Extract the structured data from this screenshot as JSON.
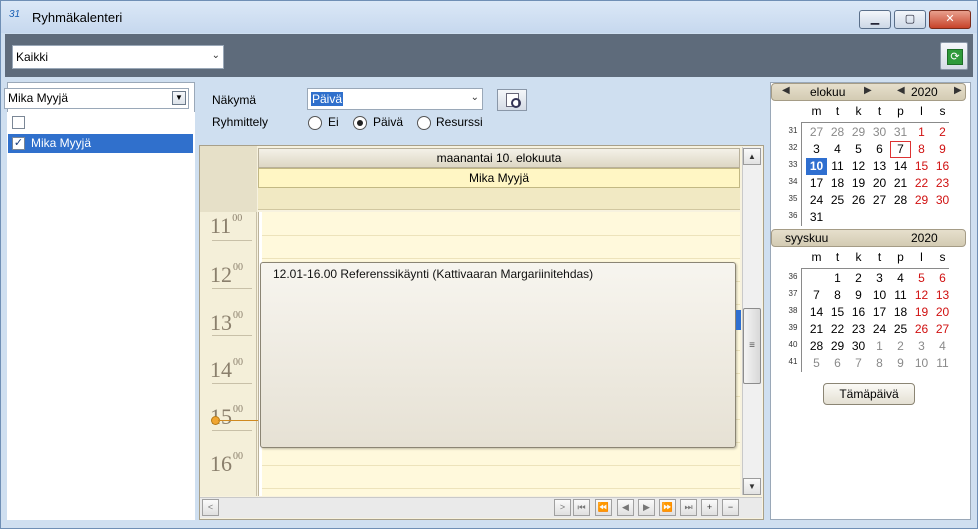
{
  "window": {
    "title": "Ryhmäkalenteri",
    "app_icon": "31",
    "buttons": {
      "minimize": "minimize-icon",
      "maximize": "maximize-icon",
      "close": "close-icon"
    }
  },
  "toolbar": {
    "filter_value": "Kaikki",
    "refresh_icon": "refresh-icon"
  },
  "left": {
    "user_select": "Mika Myyjä",
    "users": [
      {
        "label": "Mika Myyjä",
        "checked": true
      }
    ]
  },
  "controls": {
    "view_label": "Näkymä",
    "view_value": "Päivä",
    "grouping_label": "Ryhmittely",
    "grouping_options": [
      "Ei",
      "Päivä",
      "Resurssi"
    ],
    "grouping_selected": "Päivä"
  },
  "dayview": {
    "date_header": "maanantai 10. elokuuta",
    "resource_header": "Mika Myyjä",
    "hours": [
      {
        "h": "11",
        "m": "00"
      },
      {
        "h": "12",
        "m": "00"
      },
      {
        "h": "13",
        "m": "00"
      },
      {
        "h": "14",
        "m": "00"
      },
      {
        "h": "15",
        "m": "00"
      },
      {
        "h": "16",
        "m": "00"
      }
    ],
    "appointment": "12.01-16.00 Referenssikäynti (Kattivaaran Margariinitehdas)"
  },
  "navbar": [
    ">",
    "⏮",
    "⏪",
    "◀",
    "▶",
    "⏩",
    "⏭",
    "+",
    "−"
  ],
  "minical": {
    "weekday_headers": [
      "m",
      "t",
      "k",
      "t",
      "p",
      "l",
      "s"
    ],
    "months": [
      {
        "name": "elokuu",
        "year": "2020",
        "weeks": [
          {
            "wk": "31",
            "days": [
              "27",
              "28",
              "29",
              "30",
              "31",
              "1",
              "2"
            ],
            "other": [
              1,
              1,
              1,
              1,
              1,
              0,
              0
            ]
          },
          {
            "wk": "32",
            "days": [
              "3",
              "4",
              "5",
              "6",
              "7",
              "8",
              "9"
            ],
            "other": [
              0,
              0,
              0,
              0,
              0,
              0,
              0
            ]
          },
          {
            "wk": "33",
            "days": [
              "10",
              "11",
              "12",
              "13",
              "14",
              "15",
              "16"
            ],
            "other": [
              0,
              0,
              0,
              0,
              0,
              0,
              0
            ]
          },
          {
            "wk": "34",
            "days": [
              "17",
              "18",
              "19",
              "20",
              "21",
              "22",
              "23"
            ],
            "other": [
              0,
              0,
              0,
              0,
              0,
              0,
              0
            ]
          },
          {
            "wk": "35",
            "days": [
              "24",
              "25",
              "26",
              "27",
              "28",
              "29",
              "30"
            ],
            "other": [
              0,
              0,
              0,
              0,
              0,
              0,
              0
            ]
          },
          {
            "wk": "36",
            "days": [
              "31",
              "",
              "",
              "",
              "",
              "",
              ""
            ],
            "other": [
              0,
              0,
              0,
              0,
              0,
              0,
              0
            ]
          }
        ],
        "today": "10",
        "selected": "7"
      },
      {
        "name": "syyskuu",
        "year": "2020",
        "weeks": [
          {
            "wk": "36",
            "days": [
              "",
              "1",
              "2",
              "3",
              "4",
              "5",
              "6"
            ],
            "other": [
              0,
              0,
              0,
              0,
              0,
              0,
              0
            ]
          },
          {
            "wk": "37",
            "days": [
              "7",
              "8",
              "9",
              "10",
              "11",
              "12",
              "13"
            ],
            "other": [
              0,
              0,
              0,
              0,
              0,
              0,
              0
            ]
          },
          {
            "wk": "38",
            "days": [
              "14",
              "15",
              "16",
              "17",
              "18",
              "19",
              "20"
            ],
            "other": [
              0,
              0,
              0,
              0,
              0,
              0,
              0
            ]
          },
          {
            "wk": "39",
            "days": [
              "21",
              "22",
              "23",
              "24",
              "25",
              "26",
              "27"
            ],
            "other": [
              0,
              0,
              0,
              0,
              0,
              0,
              0
            ]
          },
          {
            "wk": "40",
            "days": [
              "28",
              "29",
              "30",
              "1",
              "2",
              "3",
              "4"
            ],
            "other": [
              0,
              0,
              0,
              1,
              1,
              1,
              1
            ]
          },
          {
            "wk": "41",
            "days": [
              "5",
              "6",
              "7",
              "8",
              "9",
              "10",
              "11"
            ],
            "other": [
              1,
              1,
              1,
              1,
              1,
              1,
              1
            ]
          }
        ]
      }
    ],
    "today_button": "Tämäpäivä"
  },
  "colors": {
    "accent": "#3070cc",
    "weekend": "#d01010",
    "appointment_bg": "#eeebe2"
  }
}
